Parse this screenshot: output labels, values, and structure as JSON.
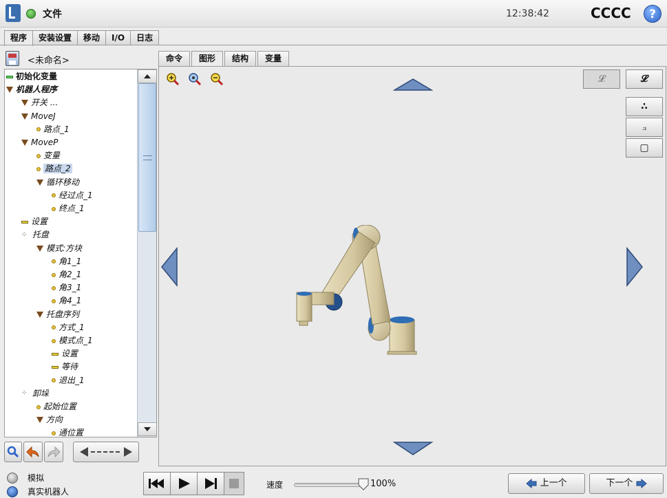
{
  "header": {
    "file_menu": "文件",
    "clock": "12:38:42",
    "robot_name": "CCCC",
    "help_label": "?"
  },
  "main_tabs": [
    "程序",
    "安装设置",
    "移动",
    "I/O",
    "日志"
  ],
  "program": {
    "name": "<未命名>"
  },
  "tree": [
    {
      "label": "初始化变量",
      "depth": 0,
      "icon": "bar-green",
      "style": "bold"
    },
    {
      "label": "机器人程序",
      "depth": 0,
      "icon": "triangle",
      "style": "bold-italic"
    },
    {
      "label": "开关 ...",
      "depth": 1,
      "icon": "triangle",
      "style": "italic"
    },
    {
      "label": "MoveJ",
      "depth": 1,
      "icon": "triangle",
      "style": "italic"
    },
    {
      "label": "路点_1",
      "depth": 2,
      "icon": "dot",
      "style": "italic"
    },
    {
      "label": "MoveP",
      "depth": 1,
      "icon": "triangle",
      "style": "italic"
    },
    {
      "label": "变量",
      "depth": 2,
      "icon": "dot",
      "style": "italic"
    },
    {
      "label": "路点_2",
      "depth": 2,
      "icon": "dot",
      "style": "italic",
      "selected": true
    },
    {
      "label": "循环移动",
      "depth": 2,
      "icon": "triangle",
      "style": "italic"
    },
    {
      "label": "经过点_1",
      "depth": 3,
      "icon": "dot",
      "style": "italic"
    },
    {
      "label": "终点_1",
      "depth": 3,
      "icon": "dot",
      "style": "italic"
    },
    {
      "label": "设置",
      "depth": 1,
      "icon": "bar",
      "style": "italic"
    },
    {
      "label": "托盘",
      "depth": 1,
      "icon": "pallet",
      "style": "italic"
    },
    {
      "label": "模式:方块",
      "depth": 2,
      "icon": "triangle",
      "style": "italic"
    },
    {
      "label": "角1_1",
      "depth": 3,
      "icon": "dot",
      "style": "italic"
    },
    {
      "label": "角2_1",
      "depth": 3,
      "icon": "dot",
      "style": "italic"
    },
    {
      "label": "角3_1",
      "depth": 3,
      "icon": "dot",
      "style": "italic"
    },
    {
      "label": "角4_1",
      "depth": 3,
      "icon": "dot",
      "style": "italic"
    },
    {
      "label": "托盘序列",
      "depth": 2,
      "icon": "triangle",
      "style": "italic"
    },
    {
      "label": "方式_1",
      "depth": 3,
      "icon": "dot",
      "style": "italic"
    },
    {
      "label": "模式点_1",
      "depth": 3,
      "icon": "dot",
      "style": "italic"
    },
    {
      "label": "设置",
      "depth": 3,
      "icon": "bar",
      "style": "italic"
    },
    {
      "label": "等待",
      "depth": 3,
      "icon": "bar",
      "style": "italic"
    },
    {
      "label": "退出_1",
      "depth": 3,
      "icon": "dot",
      "style": "italic"
    },
    {
      "label": "卸垛",
      "depth": 1,
      "icon": "pallet",
      "style": "italic"
    },
    {
      "label": "起始位置",
      "depth": 2,
      "icon": "dot",
      "style": "italic"
    },
    {
      "label": "方向",
      "depth": 2,
      "icon": "triangle",
      "style": "italic"
    },
    {
      "label": "通位置",
      "depth": 3,
      "icon": "dot",
      "style": "italic"
    }
  ],
  "sub_tabs": [
    "命令",
    "图形",
    "结构",
    "变量"
  ],
  "active_sub_tab": 1,
  "view_icons": [
    "zoom-in-icon",
    "zoom-reset-icon",
    "zoom-out-icon"
  ],
  "view_buttons": {
    "path_left": "𝓛",
    "path_right": "𝓛",
    "points": "∴",
    "trajectory": "⟓",
    "box": "▢"
  },
  "bottom": {
    "simulation_label": "模拟",
    "real_robot_label": "真实机器人",
    "speed_label": "速度",
    "speed_value": "100%",
    "speed_fraction": 1.0,
    "prev_label": "上一个",
    "next_label": "下一个"
  },
  "colors": {
    "accent_blue": "#2b63c8",
    "status_green": "#2f8f2a",
    "nav_arrow_blue": "#3d5e92",
    "robot_tan": "#d8cca6"
  }
}
